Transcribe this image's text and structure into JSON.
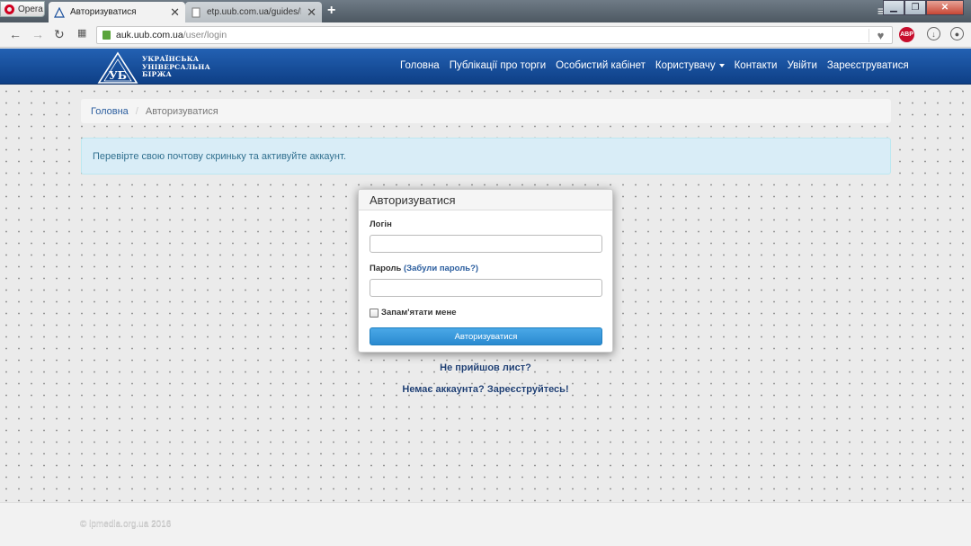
{
  "browser": {
    "menu_label": "Opera",
    "tabs": [
      {
        "title": "Авторизуватися",
        "active": true
      },
      {
        "title": "etp.uub.com.ua/guides/Ke...",
        "active": false
      }
    ],
    "new_tab": "+",
    "url_host": "auk.uub.com.ua",
    "url_path": "/user/login",
    "adblock_label": "ABP"
  },
  "site": {
    "logo_mark": "УБ",
    "logo_lines": [
      "УКРАЇНСЬКА",
      "УНІВЕРСАЛЬНА",
      "БІРЖА"
    ],
    "nav": [
      {
        "label": "Головна"
      },
      {
        "label": "Публікації про торги"
      },
      {
        "label": "Особистий кабінет"
      },
      {
        "label": "Користувачу",
        "dropdown": true
      },
      {
        "label": "Контакти"
      },
      {
        "label": "Увійти"
      },
      {
        "label": "Зареєструватися"
      }
    ]
  },
  "breadcrumb": {
    "home": "Головна",
    "separator": "/",
    "current": "Авторизуватися"
  },
  "alert": {
    "text": "Перевірте свою почтову скриньку та активуйте аккаунт."
  },
  "login_panel": {
    "heading": "Авторизуватися",
    "login_label": "Логін",
    "login_value": "",
    "password_label": "Пароль",
    "forgot_link": "(Забули пароль?)",
    "password_value": "",
    "remember_label": "Запам'ятати мене",
    "remember_checked": false,
    "submit_label": "Авторизуватися"
  },
  "links": {
    "resend": "Не прийшов лист?",
    "register": "Немає аккаунта? Зареєструйтесь!"
  },
  "footer": {
    "copyright": "© ipmedia.org.ua 2016"
  },
  "colors": {
    "header_blue": "#1a4f9c",
    "button_blue": "#3a9ade",
    "alert_bg": "#d9edf7"
  }
}
